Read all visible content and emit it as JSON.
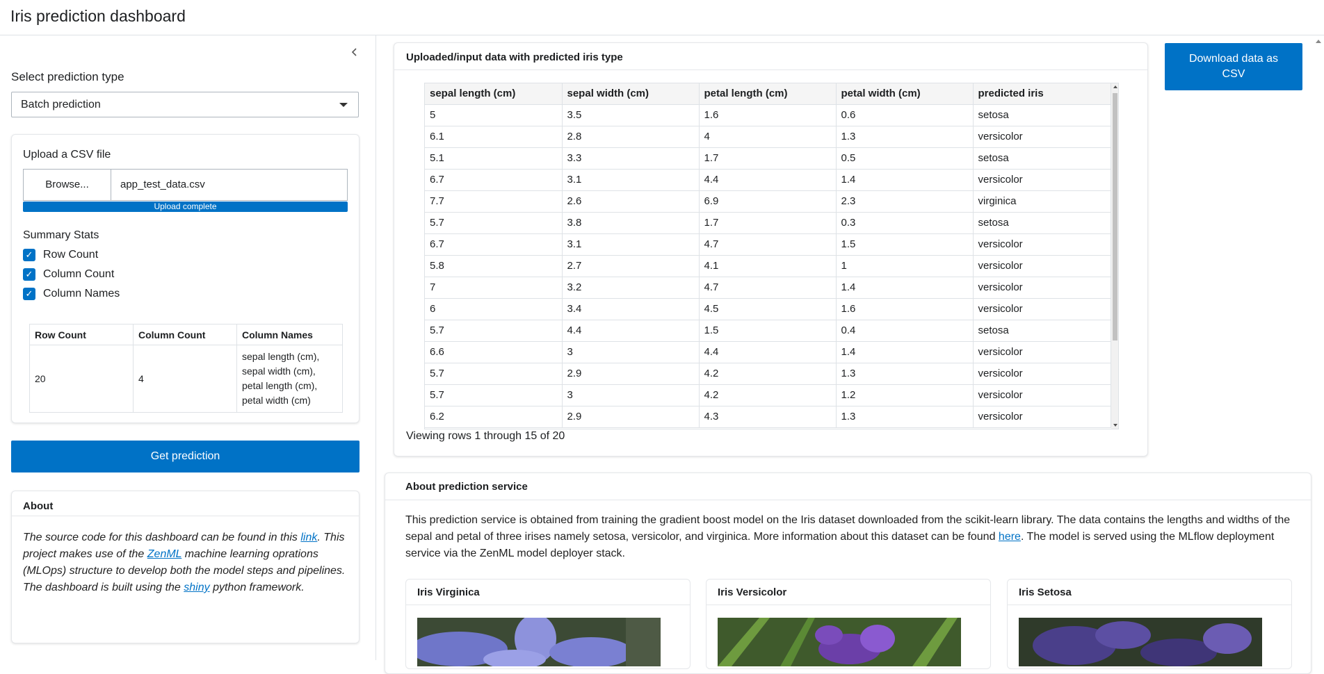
{
  "app": {
    "title": "Iris prediction dashboard"
  },
  "sidebar": {
    "select_label": "Select prediction type",
    "select_value": "Batch prediction",
    "upload_label": "Upload a CSV file",
    "browse_label": "Browse...",
    "file_name": "app_test_data.csv",
    "upload_status": "Upload complete",
    "upload_progress_pct": 100,
    "stats_label": "Summary Stats",
    "checkboxes": [
      {
        "label": "Row Count",
        "checked": true
      },
      {
        "label": "Column Count",
        "checked": true
      },
      {
        "label": "Column Names",
        "checked": true
      }
    ],
    "stats_table": {
      "headers": [
        "Row Count",
        "Column Count",
        "Column Names"
      ],
      "row_count": "20",
      "column_count": "4",
      "column_names": [
        "sepal length (cm),",
        "sepal width (cm),",
        "petal length (cm),",
        "petal width (cm)"
      ]
    },
    "predict_label": "Get prediction",
    "about_title": "About",
    "about_text": {
      "p1": "The source code for this dashboard can be found in this ",
      "link1": "link",
      "p2": ". This project makes use of the ",
      "link2": "ZenML",
      "p3": " machine learning oprations (MLOps) structure to develop both the model steps and pipelines. The dashboard is built using the ",
      "link3": "shiny",
      "p4": " python framework."
    }
  },
  "main": {
    "data_title": "Uploaded/input data with predicted iris type",
    "grid_headers": [
      "sepal length (cm)",
      "sepal width (cm)",
      "petal length (cm)",
      "petal width (cm)",
      "predicted iris"
    ],
    "grid_rows": [
      [
        "5",
        "3.5",
        "1.6",
        "0.6",
        "setosa"
      ],
      [
        "6.1",
        "2.8",
        "4",
        "1.3",
        "versicolor"
      ],
      [
        "5.1",
        "3.3",
        "1.7",
        "0.5",
        "setosa"
      ],
      [
        "6.7",
        "3.1",
        "4.4",
        "1.4",
        "versicolor"
      ],
      [
        "7.7",
        "2.6",
        "6.9",
        "2.3",
        "virginica"
      ],
      [
        "5.7",
        "3.8",
        "1.7",
        "0.3",
        "setosa"
      ],
      [
        "6.7",
        "3.1",
        "4.7",
        "1.5",
        "versicolor"
      ],
      [
        "5.8",
        "2.7",
        "4.1",
        "1",
        "versicolor"
      ],
      [
        "7",
        "3.2",
        "4.7",
        "1.4",
        "versicolor"
      ],
      [
        "6",
        "3.4",
        "4.5",
        "1.6",
        "versicolor"
      ],
      [
        "5.7",
        "4.4",
        "1.5",
        "0.4",
        "setosa"
      ],
      [
        "6.6",
        "3",
        "4.4",
        "1.4",
        "versicolor"
      ],
      [
        "5.7",
        "2.9",
        "4.2",
        "1.3",
        "versicolor"
      ],
      [
        "5.7",
        "3",
        "4.2",
        "1.2",
        "versicolor"
      ],
      [
        "6.2",
        "2.9",
        "4.3",
        "1.3",
        "versicolor"
      ]
    ],
    "viewing_text": "Viewing rows 1 through 15 of 20",
    "download_label": "Download data as CSV",
    "about_service_title": "About prediction service",
    "about_service": {
      "p1": "This prediction service is obtained from training the gradient boost model on the Iris dataset downloaded from the scikit-learn library. The data contains the lengths and widths of the sepal and petal of three irises namely setosa, versicolor, and virginica. More information about this dataset can be found ",
      "link": "here",
      "p2": ". The model is served using the MLflow deployment service via the ZenML model deployer stack."
    },
    "iris_cards": [
      {
        "title": "Iris Virginica"
      },
      {
        "title": "Iris Versicolor"
      },
      {
        "title": "Iris Setosa"
      }
    ]
  },
  "colors": {
    "accent": "#0072c6",
    "border": "#dee2e6"
  }
}
